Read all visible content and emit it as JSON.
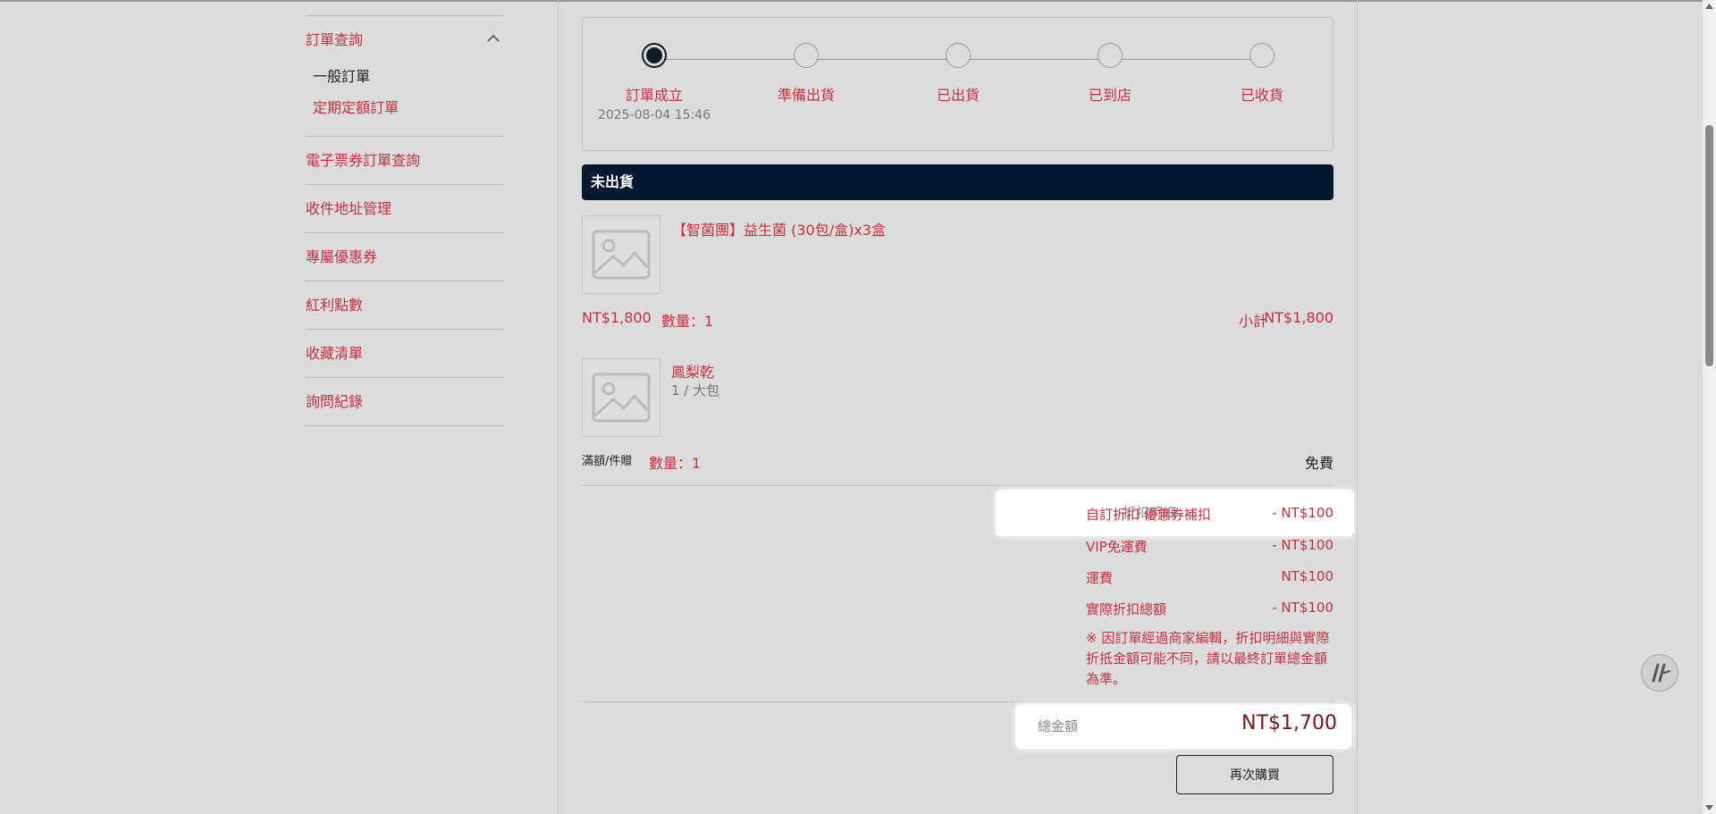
{
  "sidebar": {
    "group_title": "訂單查詢",
    "sub_items": [
      {
        "label": "一般訂單",
        "active": true
      },
      {
        "label": "定期定額訂單",
        "active": false
      }
    ],
    "items": [
      {
        "label": "電子票券訂單查詢"
      },
      {
        "label": "收件地址管理"
      },
      {
        "label": "專屬優惠券"
      },
      {
        "label": "紅利點數"
      },
      {
        "label": "收藏清單"
      },
      {
        "label": "詢問紀錄"
      }
    ]
  },
  "progress": {
    "steps": [
      {
        "label": "訂單成立",
        "time": "2025-08-04 15:46",
        "active": true
      },
      {
        "label": "準備出貨",
        "time": "",
        "active": false
      },
      {
        "label": "已出貨",
        "time": "",
        "active": false
      },
      {
        "label": "已到店",
        "time": "",
        "active": false
      },
      {
        "label": "已收貨",
        "time": "",
        "active": false
      }
    ]
  },
  "status_bar": {
    "label": "未出貨"
  },
  "items": [
    {
      "title": "【智菌團】益生菌 (30包/盒)x3盒",
      "price": "NT$1,800",
      "quantity": "數量：1",
      "subtotal_label": "小計",
      "subtotal": "NT$1,800"
    },
    {
      "title": "鳳梨乾",
      "variant": "1 / 大包",
      "tag": "滿額/件贈",
      "quantity": "數量：1",
      "price_label": "免費"
    }
  ],
  "discounts": {
    "label": "折扣明細",
    "rows": [
      {
        "name": "自訂折扣 優惠券補扣",
        "value": "- NT$100"
      },
      {
        "name": "VIP免運費",
        "value": "- NT$100"
      },
      {
        "name": "運費",
        "value": "NT$100"
      },
      {
        "name": "實際折扣總額",
        "value": "- NT$100"
      }
    ],
    "note": "※ 因訂單經過商家編輯，折扣明細與實際折抵金額可能不同，請以最終訂單總金額為準。"
  },
  "total": {
    "label": "總金額",
    "value": "NT$1,700"
  },
  "rebuy_button": "再次購買",
  "colors": {
    "accent": "#c9313c",
    "navy": "#051a30",
    "total": "#7a1418"
  }
}
